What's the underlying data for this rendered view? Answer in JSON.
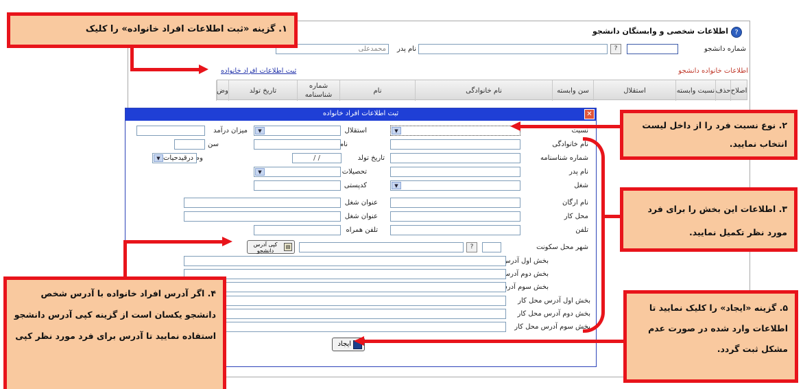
{
  "page": {
    "title": "اطلاعات شخصی و وابستگان دانشجو",
    "student_number_label": "شماره دانشجو",
    "student_number_value": "",
    "search_button": "?",
    "father_name_label": "نام پدر",
    "father_name_value": "محمدعلی",
    "family_info_label": "اطلاعات خانواده دانشجو",
    "register_family_link": "ثبت اطلاعات افراد خانواده",
    "columns": [
      "اصلاح",
      "حذف",
      "نسبت وابسته",
      "استقلال",
      "سن وابسته",
      "نام خانوادگی",
      "نام",
      "شماره شناسنامه",
      "تاریخ تولد",
      "وض"
    ]
  },
  "dialog": {
    "title": "ثبت اطلاعات افراد خانواده",
    "close": "✕",
    "fields": {
      "relation": "نسبت",
      "independence": "استقلال",
      "income": "میزان درآمد",
      "last_name": "نام خانوادگی",
      "first_name": "نام",
      "age": "سن",
      "id_number": "شماره شناسنامه",
      "birth_date": "تاریخ تولد",
      "birth_date_value": "/     /",
      "status": "وضعیت",
      "status_value": "درقیدحیات",
      "father_name": "نام پدر",
      "education": "تحصیلات",
      "job": "شغل",
      "kadpasti": "کدپستی",
      "org_name": "نام ارگان",
      "job_title_1": "عنوان شغل",
      "workplace": "محل کار",
      "job_title_2": "عنوان شغل",
      "phone": "تلفن",
      "mobile": "تلفن همراه",
      "residence_city": "شهر محل سکونت",
      "copy_address_button": "کپی آدرس دانشجو",
      "address_1": "بخش اول آدرس",
      "address_2": "بخش دوم آدرس",
      "address_3": "بخش سوم آدرس",
      "work_address_1": "بخش اول آدرس محل کار",
      "work_address_2": "بخش دوم آدرس محل کار",
      "work_address_3": "بخش سوم آدرس محل کار",
      "create_button": "ایجاد"
    }
  },
  "callouts": {
    "c1": "۱. گزینه «ثبت اطلاعات افراد خانواده» را کلیک",
    "c2": "۲. نوع نسبت فرد را از داخل لیست انتخاب نمایید.",
    "c3": "۳. اطلاعات این بخش را برای فرد مورد نظر تکمیل نمایید.",
    "c4": "۴. اگر آدرس افراد خانواده با آدرس شخص دانشجو یکسان است از گزینه کپی آدرس دانشجو استفاده نمایید تا آدرس برای فرد مورد نظر کپی",
    "c5": "۵. گزینه «ایجاد» را کلیک نمایید تا اطلاعات وارد شده در صورت عدم مشکل ثبت گردد."
  },
  "colors": {
    "callout_bg": "#f9c99f",
    "callout_border": "#e8141b",
    "dialog_title_bg": "#1f3fd6",
    "link": "#2233aa",
    "section_red": "#c0392b"
  }
}
